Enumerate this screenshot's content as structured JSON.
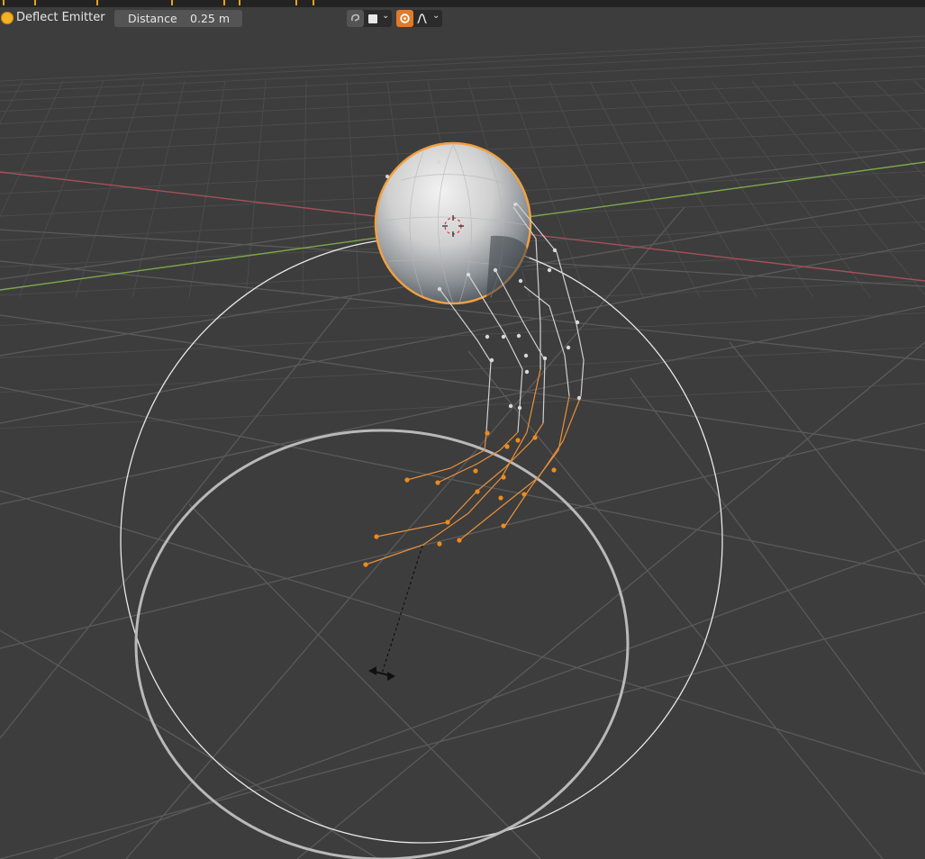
{
  "header": {
    "toggle_color": "#f1b223",
    "operator_title": "Deflect Emitter",
    "distance_label": "Distance",
    "distance_value": "0.25 m"
  },
  "toolbar": {
    "icons": [
      "proportional-edit-icon",
      "square-icon",
      "chevron-down-icon",
      "snap-falloff-icon",
      "curve-icon",
      "chevron-down-icon"
    ],
    "proportional_active_color": "#e07b2a"
  },
  "viewport": {
    "background": "#3d3d3d",
    "x_axis_color": "#a5505a",
    "y_axis_color": "#7fa64a",
    "selection_color": "#f2a040"
  }
}
